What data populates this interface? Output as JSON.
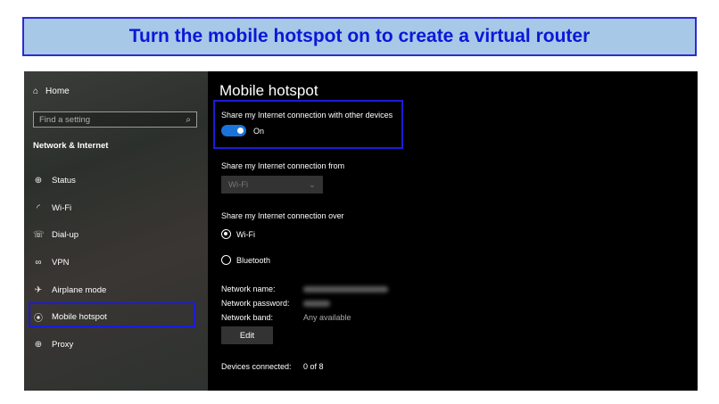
{
  "banner": {
    "text": "Turn the mobile hotspot on to create a virtual router"
  },
  "sidebar": {
    "home_label": "Home",
    "search_placeholder": "Find a setting",
    "section_title": "Network & Internet",
    "items": [
      {
        "label": "Status",
        "icon": "globe-status-icon"
      },
      {
        "label": "Wi-Fi",
        "icon": "wifi-icon"
      },
      {
        "label": "Dial-up",
        "icon": "dialup-icon"
      },
      {
        "label": "VPN",
        "icon": "vpn-icon"
      },
      {
        "label": "Airplane mode",
        "icon": "airplane-icon"
      },
      {
        "label": "Mobile hotspot",
        "icon": "hotspot-icon"
      },
      {
        "label": "Proxy",
        "icon": "globe-proxy-icon"
      }
    ]
  },
  "main": {
    "title": "Mobile hotspot",
    "share_label": "Share my Internet connection with other devices",
    "toggle_state": "On",
    "share_from_label": "Share my Internet connection from",
    "share_from_value": "Wi-Fi",
    "share_over_label": "Share my Internet connection over",
    "options": [
      "Wi-Fi",
      "Bluetooth"
    ],
    "network_name_label": "Network name:",
    "network_password_label": "Network password:",
    "network_band_label": "Network band:",
    "network_band_value": "Any available",
    "edit_label": "Edit",
    "devices_label": "Devices connected:",
    "devices_value": "0 of 8"
  },
  "colors": {
    "accent": "#1a73d8",
    "highlight": "#1c1cd8",
    "banner_bg": "#a8c8e8",
    "banner_text": "#0a18d8"
  }
}
